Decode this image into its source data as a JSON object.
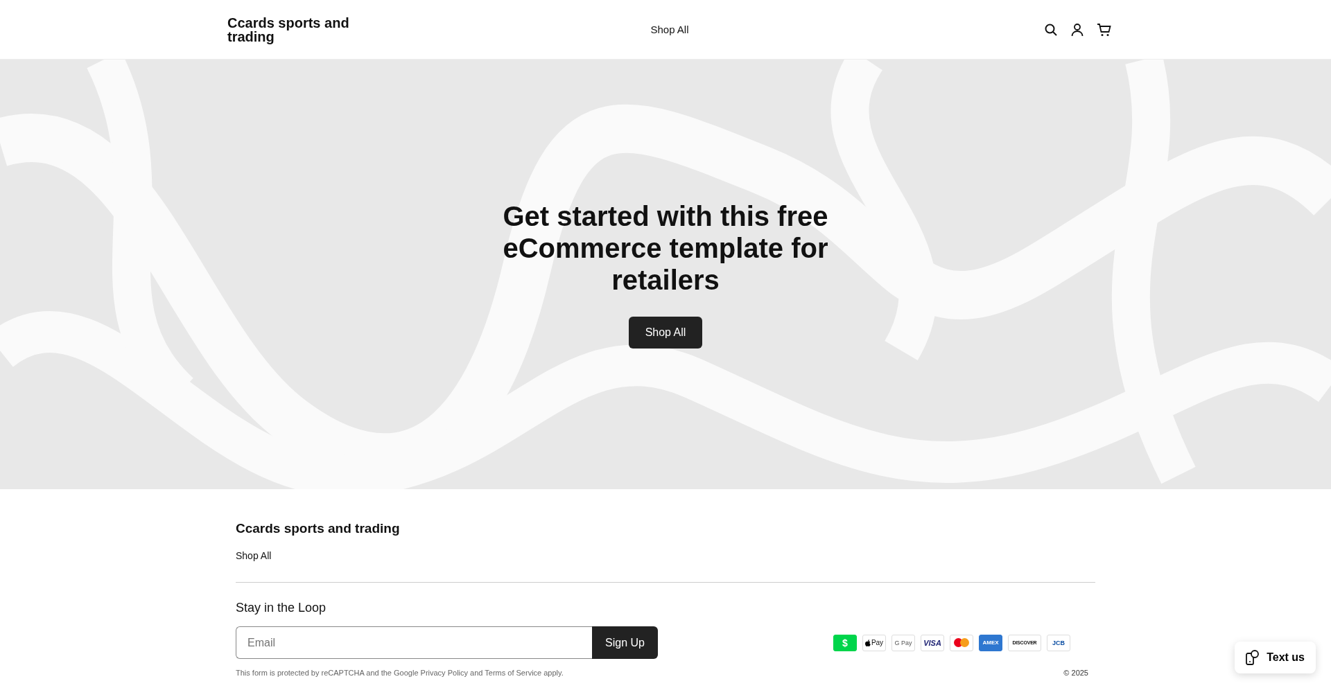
{
  "header": {
    "logo": "Ccards sports and trading",
    "nav": [
      "Shop All"
    ]
  },
  "hero": {
    "title": "Get started with this free eCommerce template for retailers",
    "button": "Shop All"
  },
  "footer": {
    "brand": "Ccards sports and trading",
    "links": [
      "Shop All"
    ],
    "newsletter": {
      "title": "Stay in the Loop",
      "placeholder": "Email",
      "button": "Sign Up"
    },
    "payments": [
      {
        "kind": "cashapp",
        "label": "$"
      },
      {
        "kind": "applepay",
        "label": "Pay"
      },
      {
        "kind": "gpay",
        "label": "G Pay"
      },
      {
        "kind": "visa",
        "label": "VISA"
      },
      {
        "kind": "mastercard"
      },
      {
        "kind": "amex",
        "label": "AMEX"
      },
      {
        "kind": "discover",
        "label": "DISCOVER"
      },
      {
        "kind": "jcb",
        "label": "JCB"
      }
    ],
    "legal": "This form is protected by reCAPTCHA and the Google Privacy Policy and Terms of Service apply.",
    "copyright": "© 2025"
  },
  "chat": {
    "label": "Text us"
  }
}
